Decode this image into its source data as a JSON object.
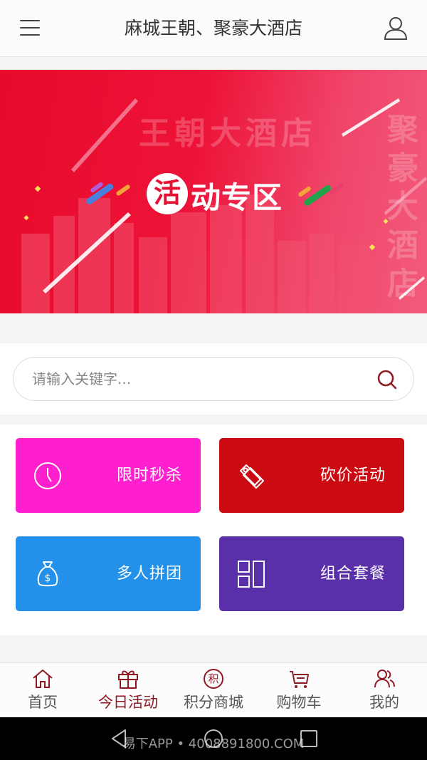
{
  "header": {
    "title": "麻城王朝、聚豪大酒店",
    "menu_icon": "menu-icon",
    "user_icon": "user-icon"
  },
  "banner": {
    "watermark_horizontal": "王朝大酒店",
    "watermark_vertical": "聚豪大酒店",
    "circle_char": "活",
    "title": "动专区",
    "background_color": "#e80a2c"
  },
  "search": {
    "placeholder": "请输入关键字...",
    "value": "",
    "icon": "search-icon",
    "icon_color": "#8f1a25"
  },
  "promotions": [
    {
      "label": "限时秒杀",
      "icon": "clock-icon",
      "color": "#ff1fce"
    },
    {
      "label": "砍价活动",
      "icon": "price-tag-icon",
      "color": "#cb0a12"
    },
    {
      "label": "多人拼团",
      "icon": "money-bag-icon",
      "color": "#2391ea"
    },
    {
      "label": "组合套餐",
      "icon": "grid-icon",
      "color": "#5930a9"
    }
  ],
  "tabbar": {
    "active_color": "#8f1a25",
    "tabs": [
      {
        "label": "首页",
        "icon": "home-icon",
        "active": false
      },
      {
        "label": "今日活动",
        "icon": "gift-icon",
        "active": true
      },
      {
        "label": "积分商城",
        "icon": "points-icon",
        "active": false,
        "icon_char": "积"
      },
      {
        "label": "购物车",
        "icon": "cart-icon",
        "active": false
      },
      {
        "label": "我的",
        "icon": "profile-icon",
        "active": false
      }
    ]
  },
  "system_nav": {
    "buttons": [
      "back-icon",
      "home-circle-icon",
      "recent-apps-icon"
    ],
    "watermark": "易下APP • 4008891800.COM"
  }
}
